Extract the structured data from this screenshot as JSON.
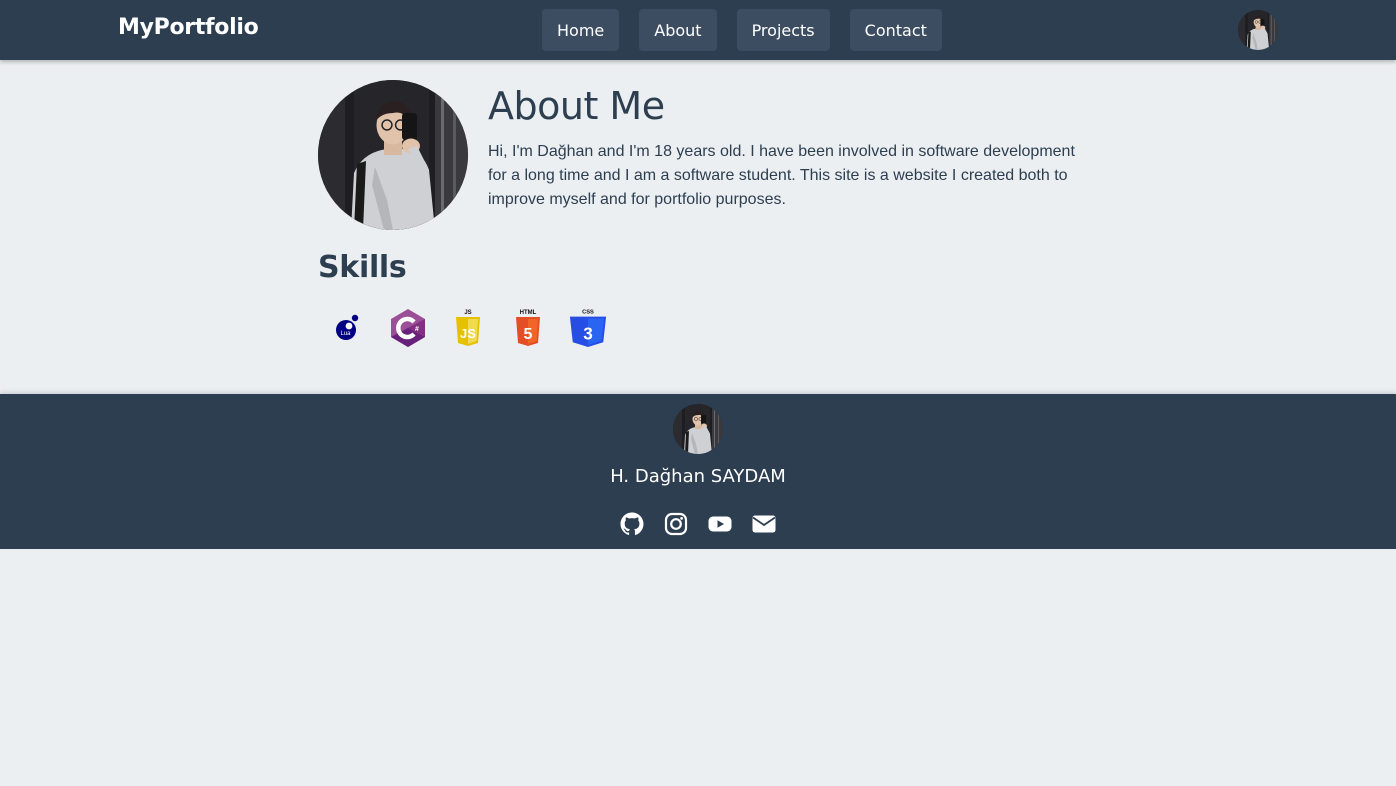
{
  "nav": {
    "brand": "MyPortfolio",
    "links": [
      {
        "label": "Home"
      },
      {
        "label": "About"
      },
      {
        "label": "Projects"
      },
      {
        "label": "Contact"
      }
    ]
  },
  "about": {
    "title": "About Me",
    "text": "Hi, I'm Dağhan and I'm 18 years old. I have been involved in software development for a long time and I am a software student. This site is a website I created both to improve myself and for portfolio purposes."
  },
  "skills": {
    "title": "Skills",
    "icons": [
      "lua-icon",
      "csharp-icon",
      "javascript-icon",
      "html5-icon",
      "css3-icon"
    ],
    "icon_text": {
      "javascript": "JS",
      "html": "HTML",
      "css": "CSS"
    }
  },
  "footer": {
    "name": "H. Dağhan SAYDAM",
    "socials": [
      "github-icon",
      "instagram-icon",
      "youtube-icon",
      "email-icon"
    ]
  },
  "colors": {
    "navbar": "#2c3e50",
    "nav_button": "#3d4d61",
    "background": "#eceff1",
    "text": "#2c3e50",
    "lua": "#000080",
    "csharp": "#68217a",
    "javascript": "#f0db4f",
    "html": "#e44d26",
    "css": "#264de4"
  }
}
